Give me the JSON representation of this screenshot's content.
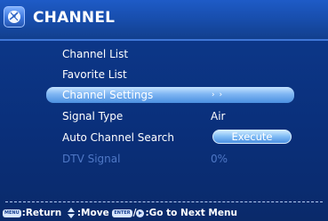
{
  "header": {
    "title": "CHANNEL",
    "icon": "satellite-dish-icon"
  },
  "menu": {
    "items": [
      {
        "label": "Channel List"
      },
      {
        "label": "Favorite List"
      },
      {
        "label": "Channel Settings",
        "value": "› ›"
      },
      {
        "label": "Signal Type",
        "value": "Air"
      },
      {
        "label": "Auto Channel Search",
        "button": "Execute"
      },
      {
        "label": "DTV Signal",
        "value": "0%"
      }
    ]
  },
  "footer": {
    "menu_key": "MENU",
    "return_label": ":Return",
    "move_label": ":Move",
    "enter_key": "ENTER",
    "next_label": ":Go to Next Menu"
  },
  "colors": {
    "background": "#0d3a8e",
    "header": "#1e5bc7",
    "highlight": "#7fb6f3",
    "disabled_text": "#4f78c6"
  }
}
